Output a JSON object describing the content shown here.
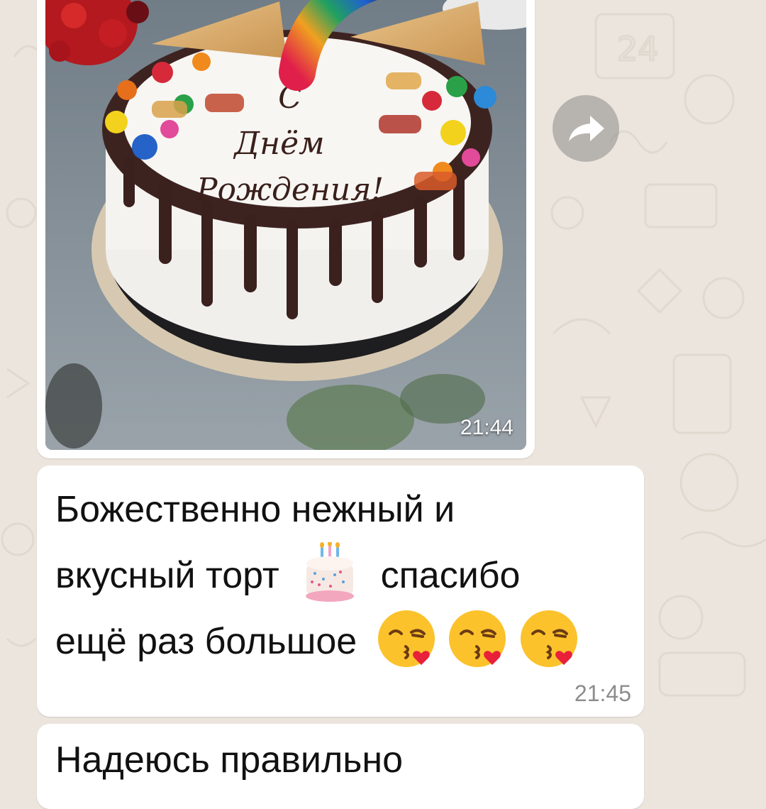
{
  "chat": {
    "messages": [
      {
        "type": "image",
        "time": "21:44",
        "image_inscription": "С Днём Рождения!"
      },
      {
        "type": "text",
        "lines": [
          "Божественно нежный и",
          "вкусный торт",
          "спасибо",
          "ещё раз большое"
        ],
        "time": "21:45",
        "emojis": [
          "birthday-cake",
          "face-blowing-a-kiss",
          "face-blowing-a-kiss",
          "face-blowing-a-kiss"
        ]
      },
      {
        "type": "text",
        "text": "Надеюсь правильно"
      }
    ]
  },
  "icons": {
    "forward": "forward-share-icon"
  },
  "colors": {
    "chat_background": "#ece5dd",
    "bubble": "#ffffff",
    "timestamp": "#8c8c8c",
    "forward_button": "#787878"
  }
}
